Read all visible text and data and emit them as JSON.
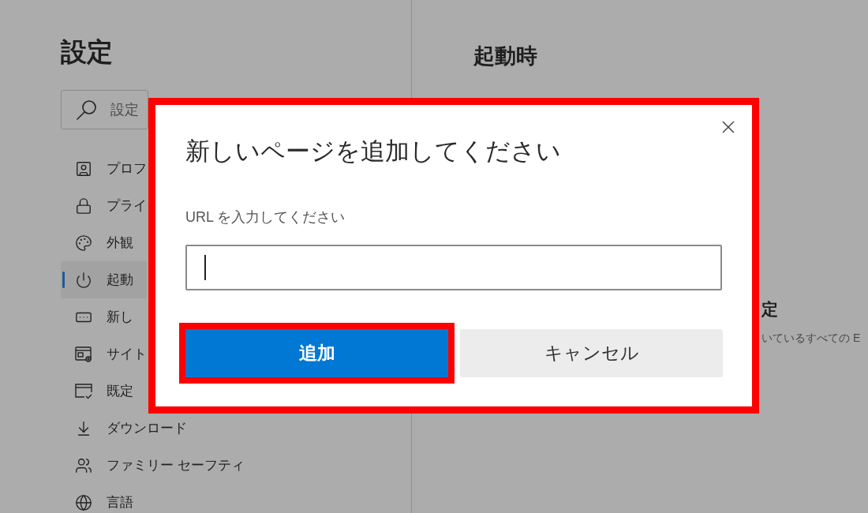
{
  "sidebar": {
    "title": "設定",
    "search": {
      "placeholder": "設定"
    },
    "items": [
      {
        "label": "プロフ",
        "selected": false
      },
      {
        "label": "プライ",
        "selected": false
      },
      {
        "label": "外観",
        "selected": false
      },
      {
        "label": "起動",
        "selected": true
      },
      {
        "label": "新し",
        "selected": false
      },
      {
        "label": "サイト",
        "selected": false
      },
      {
        "label": "既定",
        "selected": false
      },
      {
        "label": "ダウンロード",
        "selected": false
      },
      {
        "label": "ファミリー セーフティ",
        "selected": false
      },
      {
        "label": "言語",
        "selected": false
      }
    ]
  },
  "main": {
    "heading": "起動時",
    "section": {
      "title": "定",
      "description": "いているすべての E"
    }
  },
  "dialog": {
    "highlighted": true,
    "title": "新しいページを追加してください",
    "url_field": {
      "label": "URL を入力してください",
      "focused": true
    },
    "buttons": [
      {
        "label": "追加",
        "kind": "primary",
        "highlighted": true
      },
      {
        "label": "キャンセル",
        "kind": "secondary",
        "highlighted": false
      }
    ]
  }
}
